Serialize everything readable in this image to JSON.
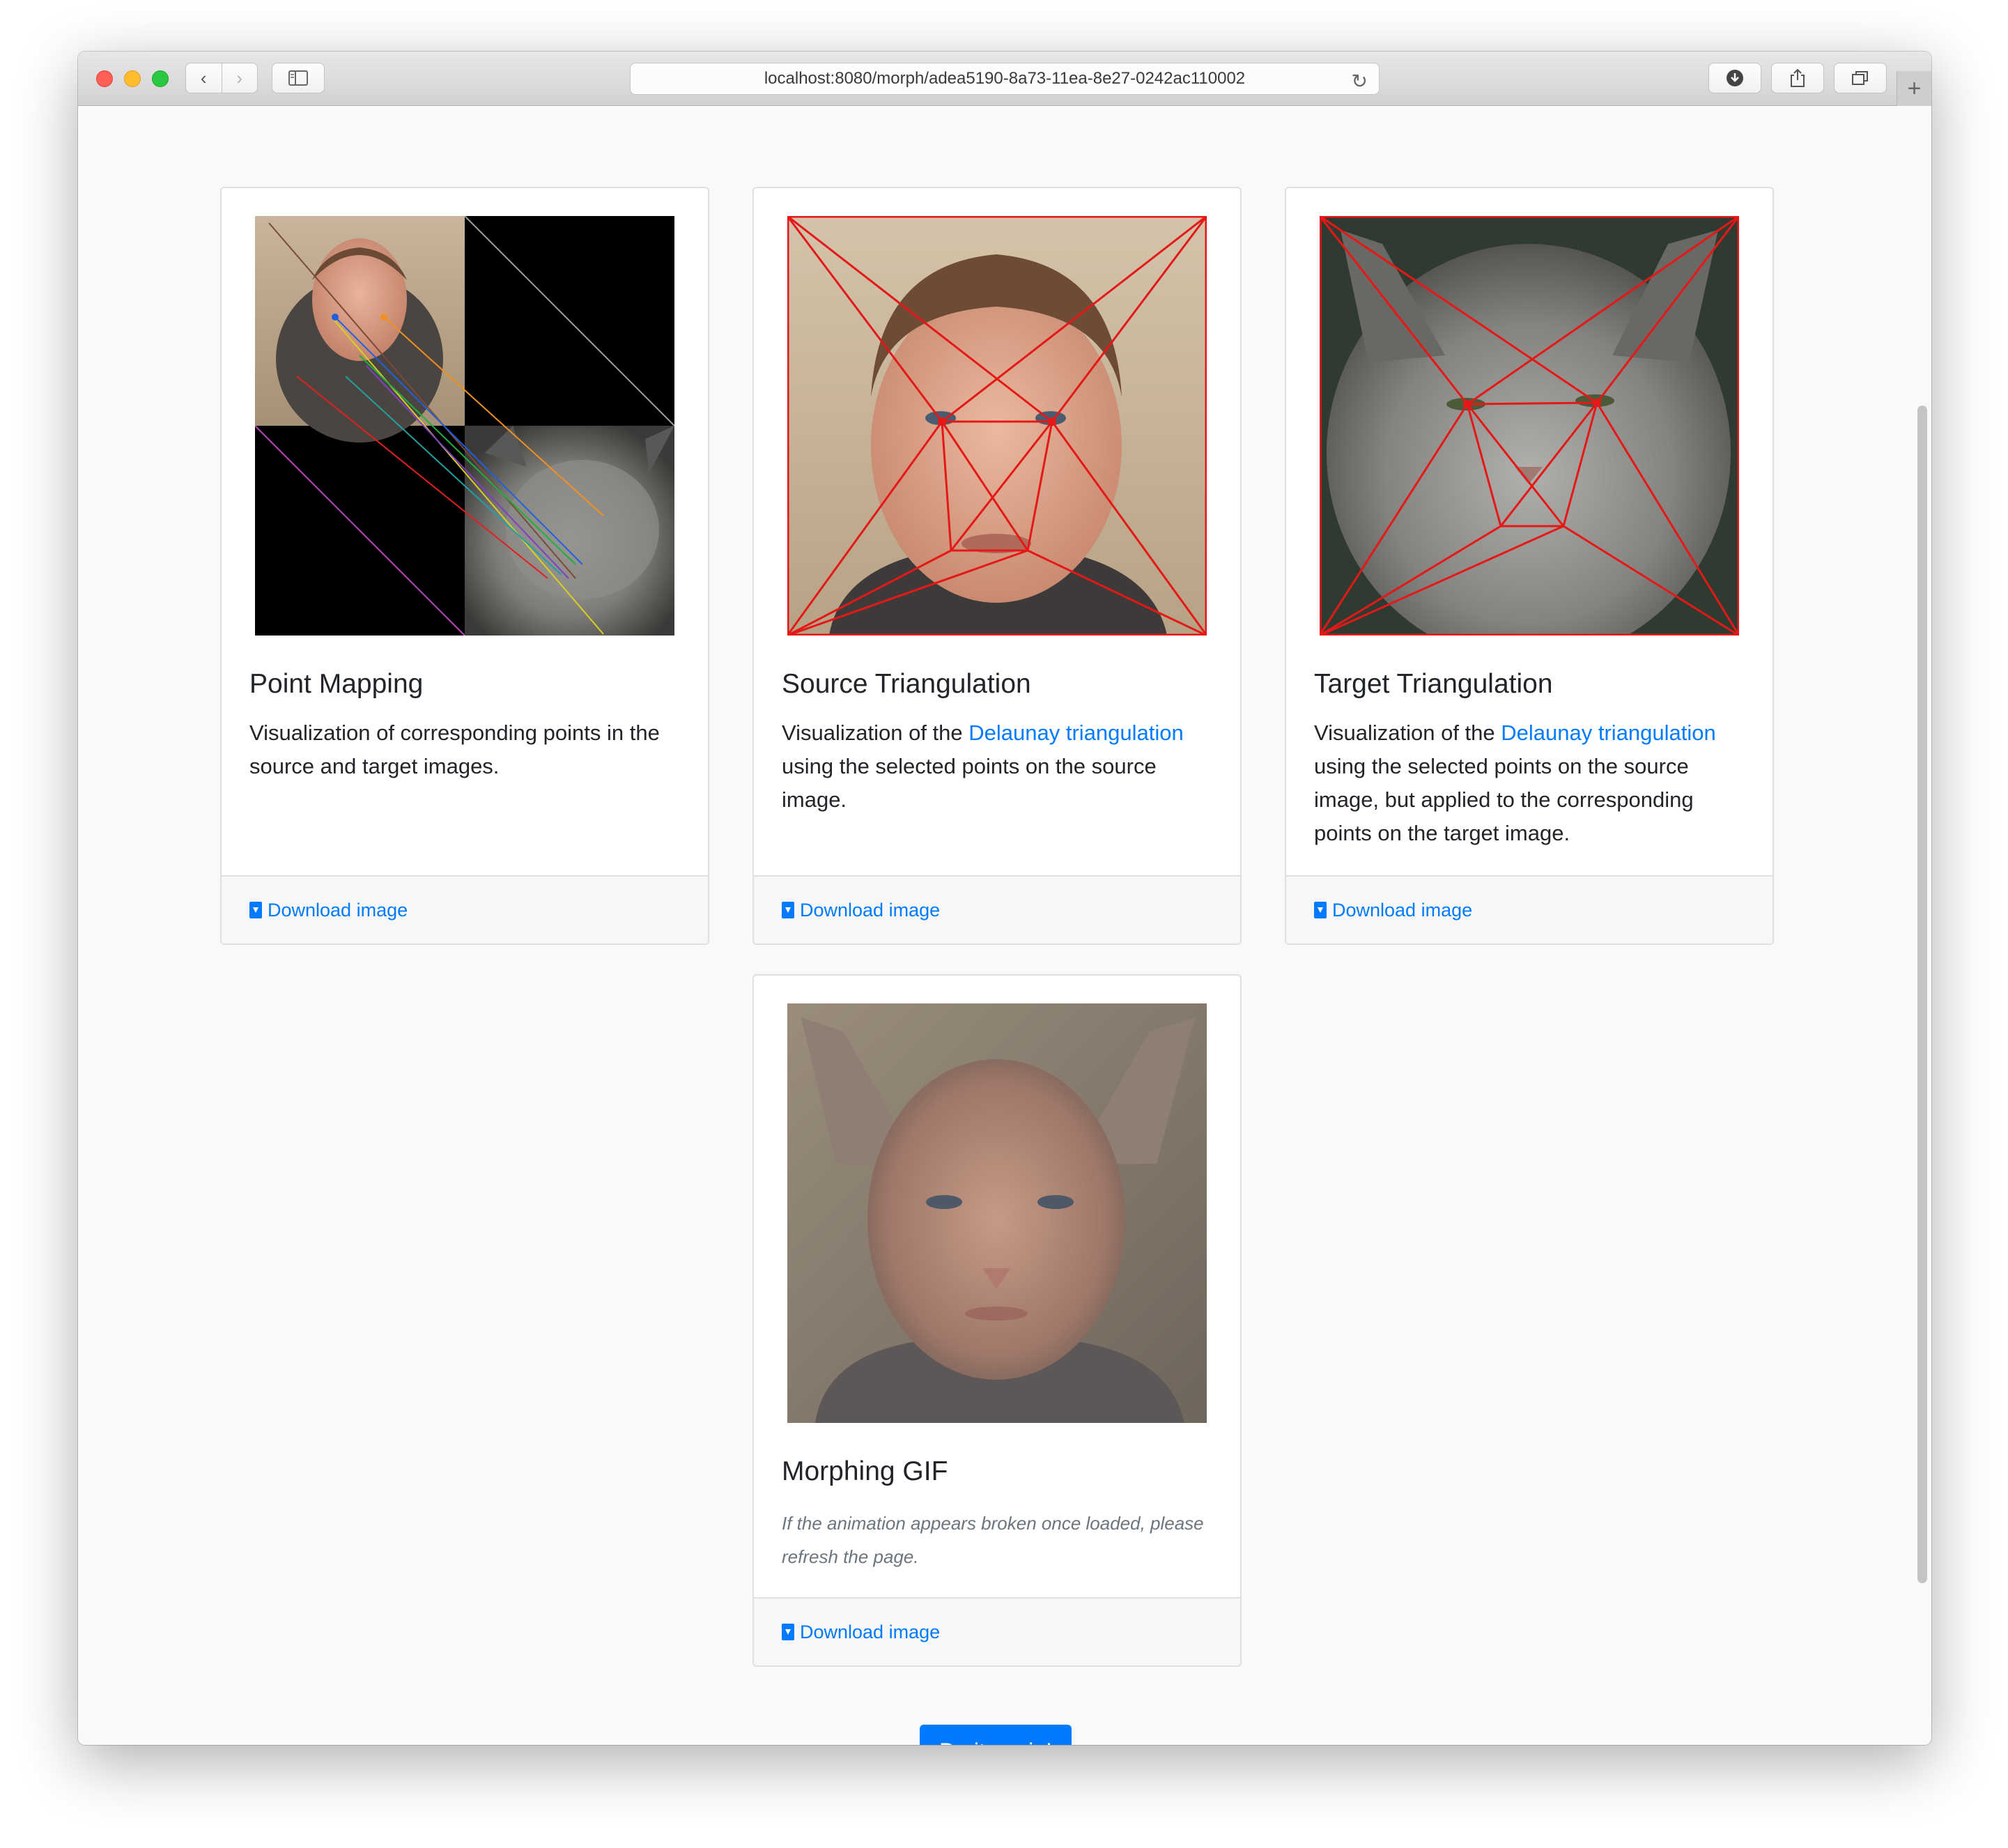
{
  "browser": {
    "url": "localhost:8080/morph/adea5190-8a73-11ea-8e27-0242ac110002"
  },
  "cards": [
    {
      "title": "Point Mapping",
      "text": "Visualization of corresponding points in the source and target images.",
      "footer": "Download image"
    },
    {
      "title": "Source Triangulation",
      "text_pre": "Visualization of the ",
      "link": "Delaunay triangulation",
      "text_post": " using the selected points on the source image.",
      "footer": "Download image"
    },
    {
      "title": "Target Triangulation",
      "text_pre": "Visualization of the ",
      "link": "Delaunay triangulation",
      "text_post": " using the selected points on the source image, but applied to the corresponding points on the target image.",
      "footer": "Download image"
    },
    {
      "title": "Morphing GIF",
      "note": "If the animation appears broken once loaded, please refresh the page.",
      "footer": "Download image"
    }
  ],
  "action_button": "Do it again!",
  "colors": {
    "link": "#007bff",
    "triangulation": "#e51818"
  }
}
